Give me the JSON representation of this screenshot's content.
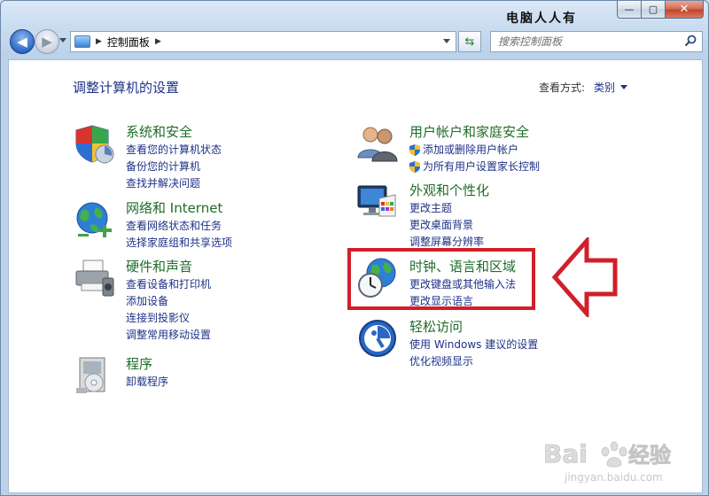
{
  "window": {
    "caption": "电脑人人有",
    "buttons": {
      "min": "—",
      "max": "▢",
      "close": "✕"
    }
  },
  "nav": {
    "back_glyph": "◀",
    "forward_glyph": "▶",
    "breadcrumb": "控制面板",
    "search_placeholder": "搜索控制面板"
  },
  "page": {
    "title": "调整计算机的设置",
    "view_by_label": "查看方式:",
    "view_by_value": "类别"
  },
  "categories_left": [
    {
      "title": "系统和安全",
      "icon": "shield-icon",
      "links": [
        "查看您的计算机状态",
        "备份您的计算机",
        "查找并解决问题"
      ]
    },
    {
      "title": "网络和 Internet",
      "icon": "globe-network-icon",
      "links": [
        "查看网络状态和任务",
        "选择家庭组和共享选项"
      ]
    },
    {
      "title": "硬件和声音",
      "icon": "printer-icon",
      "links": [
        "查看设备和打印机",
        "添加设备",
        "连接到投影仪",
        "调整常用移动设置"
      ]
    },
    {
      "title": "程序",
      "icon": "programs-icon",
      "links": [
        "卸载程序"
      ]
    }
  ],
  "categories_right": [
    {
      "title": "用户帐户和家庭安全",
      "icon": "users-icon",
      "links": [
        "添加或删除用户帐户",
        "为所有用户设置家长控制"
      ],
      "shielded": [
        true,
        true
      ]
    },
    {
      "title": "外观和个性化",
      "icon": "monitor-paint-icon",
      "links": [
        "更改主题",
        "更改桌面背景",
        "调整屏幕分辨率"
      ]
    },
    {
      "title": "时钟、语言和区域",
      "icon": "clock-globe-icon",
      "links": [
        "更改键盘或其他输入法",
        "更改显示语言"
      ]
    },
    {
      "title": "轻松访问",
      "icon": "ease-of-access-icon",
      "links": [
        "使用 Windows 建议的设置",
        "优化视频显示"
      ]
    }
  ],
  "watermark": {
    "brand": "Bai",
    "brand2": "经验",
    "url": "jingyan.baidu.com"
  },
  "colors": {
    "heading_green": "#1f6d2a",
    "link_blue": "#1e3287",
    "highlight_red": "#d0202a"
  }
}
